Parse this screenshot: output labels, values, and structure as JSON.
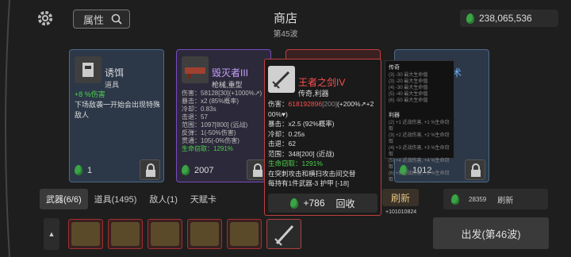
{
  "header": {
    "title": "商店",
    "wave": "第45波",
    "search_label": "属性",
    "money": "238,065,536"
  },
  "cards": [
    {
      "name": "诱饵",
      "type": "道具",
      "desc_line1": "+8 %伤害",
      "desc_line2": "下场敌袭一开始会出现特殊",
      "desc_line3": "敌人",
      "price": "1"
    },
    {
      "name": "毁灭者III",
      "type": "枪械,重型",
      "stats": [
        "伤害：58128[30](+1000%↗)",
        "暴击：x2 (85%概率)",
        "冷却：0.83s",
        "击退：57",
        "范围：1097[800] (远战)",
        "反弹：1(-50%伤害)",
        "贯通：105(-0%伤害)",
        "生命窃取：1291%"
      ],
      "price": "2007"
    },
    {
      "name": "术",
      "price": "1012"
    }
  ],
  "tooltip": {
    "name": "王者之剑IV",
    "type": "传奇,利器",
    "dmg_label": "伤害：",
    "dmg_value": "618192896",
    "dmg_base": "[200]",
    "dmg_scaling": "(+200%↗+2",
    "dmg_scaling2": "00%♥)",
    "crit": "暴击：x2.5 (92%概率)",
    "cooldown": "冷却：0.25s",
    "knockback": "击退：62",
    "range": "范围：348[200] (近战)",
    "lifesteal": "生命窃取：1291%",
    "effect1": "在突刺攻击和横扫攻击间交替",
    "effect2": "每持有1件武器-3 护甲 [-18]",
    "recycle_value": "+786",
    "recycle_label": "回收"
  },
  "side_panel": {
    "title1": "传奇",
    "lines1": [
      "(3) -30 最大生命值",
      "(3) -20 最大生命值",
      "(4) -30 最大生命值",
      "(5) -40 最大生命值",
      "(6) -50 最大生命值"
    ],
    "title2": "利器",
    "lines2": [
      "(2) +1 近战伤害, +1 %生命窃取",
      "(3) +2 近战伤害, +2 %生命窃取",
      "(4) +3 近战伤害, +3 %生命窃取",
      "(5) +4 近战伤害, +4 %生命窃取",
      "(6) +5 近战伤害, +5 %生命窃取"
    ]
  },
  "tabs": [
    "武器(6/6)",
    "道具(1495)",
    "敌人(1)",
    "天赋卡"
  ],
  "reroll": {
    "label": "刷新",
    "money": "+101010824",
    "cost": "28359",
    "label2": "刷新"
  },
  "depart_label": "出发(第46波)",
  "colors": {
    "legendary_red": "#ff5050",
    "epic_purple": "#c8a0ff",
    "money_green": "#3aa544"
  }
}
